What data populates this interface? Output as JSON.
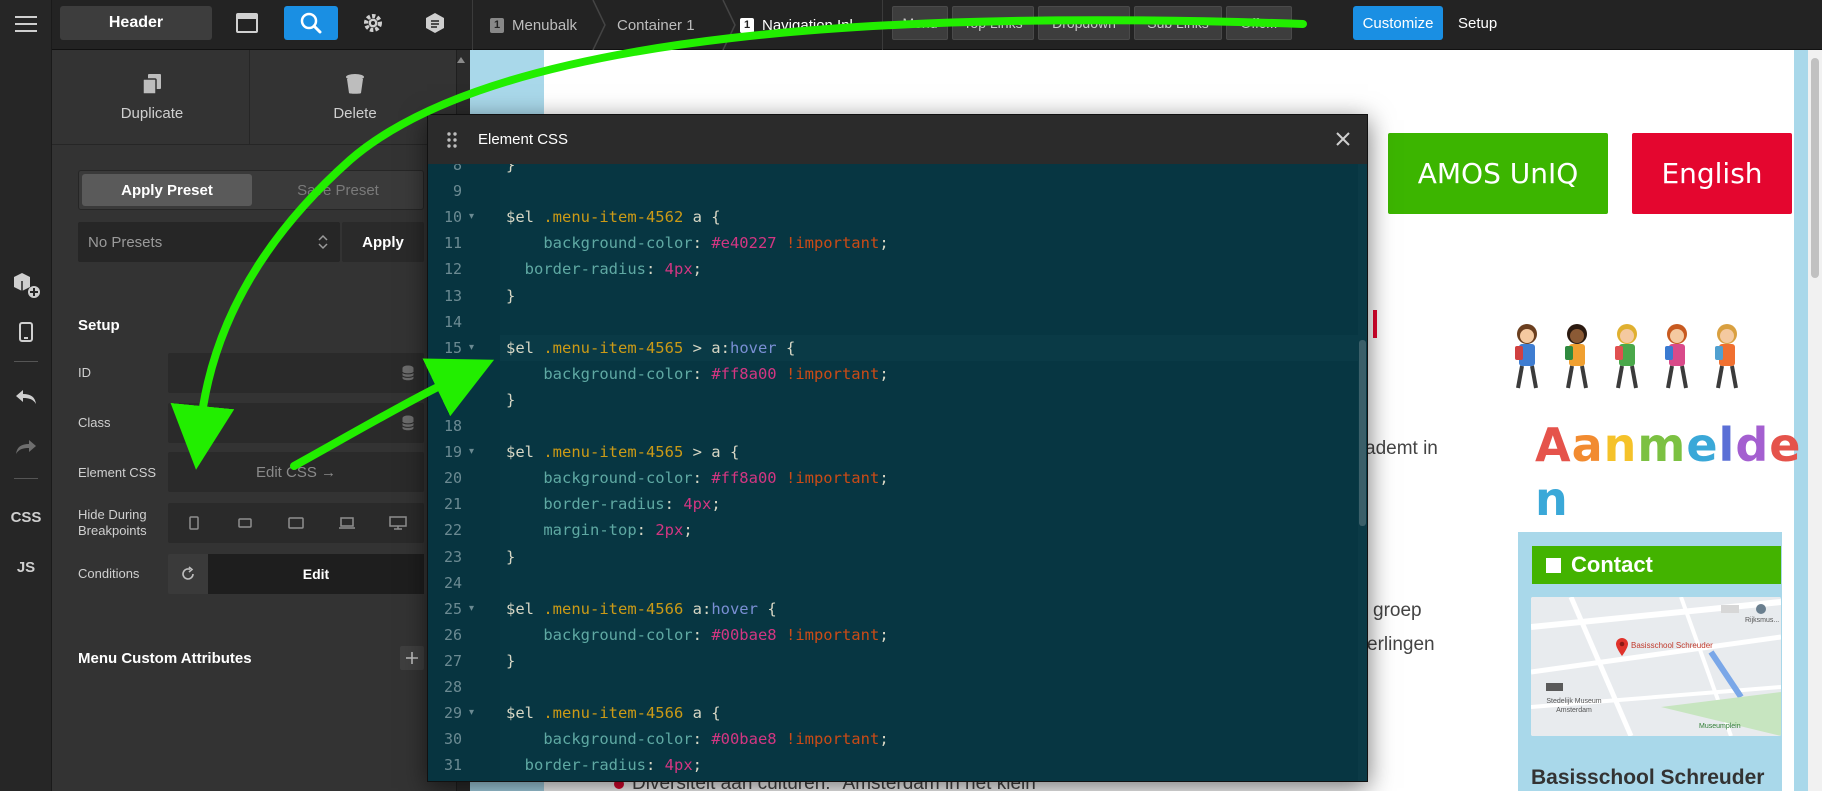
{
  "rail": {
    "css_label": "CSS",
    "js_label": "JS"
  },
  "topbar": {
    "header_label": "Header",
    "breadcrumbs": [
      {
        "num": "1",
        "label": "Menubalk"
      },
      {
        "num": "",
        "label": "Container 1"
      },
      {
        "num": "1",
        "label": "Navigation Inl..."
      }
    ],
    "child_tabs": [
      "Menu",
      "Top Links",
      "Dropdown",
      "Sub Links",
      "Offc..."
    ],
    "customize_label": "Customize",
    "setup_label": "Setup"
  },
  "panel": {
    "duplicate_label": "Duplicate",
    "delete_label": "Delete",
    "apply_preset_tab": "Apply Preset",
    "save_preset_tab": "Save Preset",
    "preset_select_value": "No Presets",
    "apply_button": "Apply",
    "setup_title": "Setup",
    "id_label": "ID",
    "class_label": "Class",
    "element_css_label": "Element CSS",
    "edit_css_button": "Edit CSS →",
    "hide_breakpoints_label": "Hide During Breakpoints",
    "conditions_label": "Conditions",
    "conditions_edit": "Edit",
    "menu_attrs_title": "Menu Custom Attributes"
  },
  "modal": {
    "title": "Element CSS",
    "lines": [
      {
        "n": "8",
        "fold": false,
        "segs": [
          [
            "sel",
            "}"
          ]
        ]
      },
      {
        "n": "9",
        "fold": false,
        "segs": []
      },
      {
        "n": "10",
        "fold": true,
        "segs": [
          [
            "sel",
            "$el "
          ],
          [
            "cls",
            ".menu-item-4562"
          ],
          [
            "sel",
            " a {"
          ]
        ]
      },
      {
        "n": "11",
        "fold": false,
        "segs": [
          [
            "sel",
            "    "
          ],
          [
            "prop",
            "background-color"
          ],
          [
            "sel",
            ": "
          ],
          [
            "val",
            "#e40227"
          ],
          [
            "sel",
            " "
          ],
          [
            "imp",
            "!important"
          ],
          [
            "sel",
            ";"
          ]
        ]
      },
      {
        "n": "12",
        "fold": false,
        "segs": [
          [
            "sel",
            "  "
          ],
          [
            "prop",
            "border-radius"
          ],
          [
            "sel",
            ": "
          ],
          [
            "val",
            "4px"
          ],
          [
            "sel",
            ";"
          ]
        ]
      },
      {
        "n": "13",
        "fold": false,
        "segs": [
          [
            "sel",
            "}"
          ]
        ]
      },
      {
        "n": "14",
        "fold": false,
        "segs": []
      },
      {
        "n": "15",
        "fold": true,
        "segs": [
          [
            "sel",
            "$el "
          ],
          [
            "cls",
            ".menu-item-4565"
          ],
          [
            "sel",
            " > a:"
          ],
          [
            "pseudo",
            "hover"
          ],
          [
            "sel",
            " {"
          ]
        ]
      },
      {
        "n": "16",
        "fold": false,
        "segs": [
          [
            "sel",
            "    "
          ],
          [
            "prop",
            "background-color"
          ],
          [
            "sel",
            ": "
          ],
          [
            "val",
            "#ff8a00"
          ],
          [
            "sel",
            " "
          ],
          [
            "imp",
            "!important"
          ],
          [
            "sel",
            ";"
          ]
        ]
      },
      {
        "n": "17",
        "fold": false,
        "segs": [
          [
            "sel",
            "}"
          ]
        ]
      },
      {
        "n": "18",
        "fold": false,
        "segs": []
      },
      {
        "n": "19",
        "fold": true,
        "segs": [
          [
            "sel",
            "$el "
          ],
          [
            "cls",
            ".menu-item-4565"
          ],
          [
            "sel",
            " > a {"
          ]
        ]
      },
      {
        "n": "20",
        "fold": false,
        "segs": [
          [
            "sel",
            "    "
          ],
          [
            "prop",
            "background-color"
          ],
          [
            "sel",
            ": "
          ],
          [
            "val",
            "#ff8a00"
          ],
          [
            "sel",
            " "
          ],
          [
            "imp",
            "!important"
          ],
          [
            "sel",
            ";"
          ]
        ]
      },
      {
        "n": "21",
        "fold": false,
        "segs": [
          [
            "sel",
            "    "
          ],
          [
            "prop",
            "border-radius"
          ],
          [
            "sel",
            ": "
          ],
          [
            "val",
            "4px"
          ],
          [
            "sel",
            ";"
          ]
        ]
      },
      {
        "n": "22",
        "fold": false,
        "segs": [
          [
            "sel",
            "    "
          ],
          [
            "prop",
            "margin-top"
          ],
          [
            "sel",
            ": "
          ],
          [
            "val",
            "2px"
          ],
          [
            "sel",
            ";"
          ]
        ]
      },
      {
        "n": "23",
        "fold": false,
        "segs": [
          [
            "sel",
            "}"
          ]
        ]
      },
      {
        "n": "24",
        "fold": false,
        "segs": []
      },
      {
        "n": "25",
        "fold": true,
        "segs": [
          [
            "sel",
            "$el "
          ],
          [
            "cls",
            ".menu-item-4566"
          ],
          [
            "sel",
            " a:"
          ],
          [
            "pseudo",
            "hover"
          ],
          [
            "sel",
            " {"
          ]
        ]
      },
      {
        "n": "26",
        "fold": false,
        "segs": [
          [
            "sel",
            "    "
          ],
          [
            "prop",
            "background-color"
          ],
          [
            "sel",
            ": "
          ],
          [
            "val",
            "#00bae8"
          ],
          [
            "sel",
            " "
          ],
          [
            "imp",
            "!important"
          ],
          [
            "sel",
            ";"
          ]
        ]
      },
      {
        "n": "27",
        "fold": false,
        "segs": [
          [
            "sel",
            "}"
          ]
        ]
      },
      {
        "n": "28",
        "fold": false,
        "segs": []
      },
      {
        "n": "29",
        "fold": true,
        "segs": [
          [
            "sel",
            "$el "
          ],
          [
            "cls",
            ".menu-item-4566"
          ],
          [
            "sel",
            " a {"
          ]
        ]
      },
      {
        "n": "30",
        "fold": false,
        "segs": [
          [
            "sel",
            "    "
          ],
          [
            "prop",
            "background-color"
          ],
          [
            "sel",
            ": "
          ],
          [
            "val",
            "#00bae8"
          ],
          [
            "sel",
            " "
          ],
          [
            "imp",
            "!important"
          ],
          [
            "sel",
            ";"
          ]
        ]
      },
      {
        "n": "31",
        "fold": false,
        "segs": [
          [
            "sel",
            "  "
          ],
          [
            "prop",
            "border-radius"
          ],
          [
            "sel",
            ": "
          ],
          [
            "val",
            "4px"
          ],
          [
            "sel",
            ";"
          ]
        ]
      }
    ]
  },
  "site": {
    "amos_button": "AMOS UnIQ",
    "english_button": "English",
    "aanmelden_letters": [
      "A",
      "a",
      "n",
      "m",
      "e",
      "l",
      "d",
      "e",
      "n"
    ],
    "aanmelden_colors": [
      "#e5534b",
      "#f28b30",
      "#f5c22a",
      "#7cc142",
      "#3aa8d8",
      "#5b6fd6",
      "#a45fd0",
      "#e5534b",
      "#3aa8d8"
    ],
    "body_frag_1": "ademt in",
    "body_frag_2": "groep",
    "body_frag_3": "erlingen",
    "contact_title": "Contact",
    "map_marker_label": "Basisschool Schreuder",
    "map_label_museum": "Stedelijk Museum Amsterdam",
    "map_label_museumplein": "Museumplein",
    "map_label_rijks": "Rijksmus...",
    "school_name": "Basisschool Schreuder",
    "bullet_text": "Diversiteit aan culturen: \"Amsterdam in het klein\""
  },
  "colors": {
    "accent_blue": "#1a8fe3",
    "arrow_green": "#22ee00",
    "amos_green": "#3cb500",
    "english_red": "#e4062f"
  }
}
